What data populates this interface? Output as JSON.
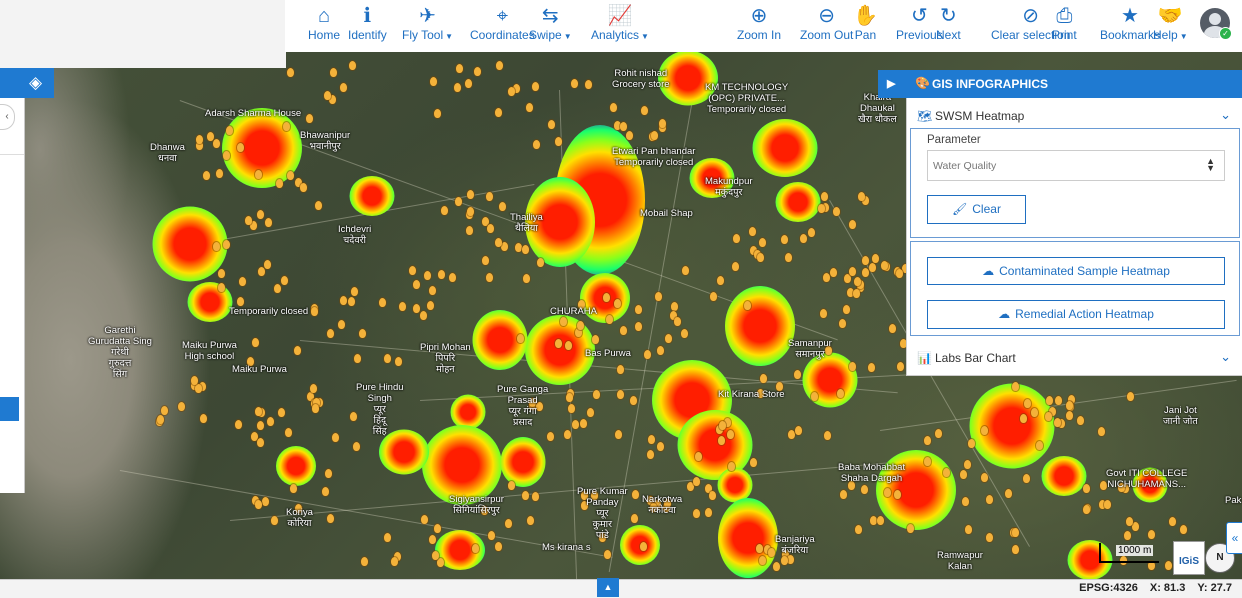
{
  "toolbar": {
    "items": [
      {
        "label": "Home",
        "icon": "home-icon",
        "glyph": "⌂"
      },
      {
        "label": "Identify",
        "icon": "info-icon",
        "glyph": "ℹ"
      },
      {
        "label": "Fly Tool",
        "icon": "fly-tool-icon",
        "glyph": "✈",
        "dropdown": true
      },
      {
        "label": "Coordinates",
        "icon": "map-pin-icon",
        "glyph": "⌖"
      },
      {
        "label": "Swipe",
        "icon": "swipe-icon",
        "glyph": "⇆",
        "dropdown": true
      },
      {
        "label": "Analytics",
        "icon": "analytics-icon",
        "glyph": "📈",
        "dropdown": true
      },
      {
        "label": "Zoom In",
        "icon": "zoom-in-icon",
        "glyph": "⊕"
      },
      {
        "label": "Zoom Out",
        "icon": "zoom-out-icon",
        "glyph": "⊖"
      },
      {
        "label": "Pan",
        "icon": "hand-icon",
        "glyph": "✋"
      },
      {
        "label": "Previous",
        "icon": "undo-icon",
        "glyph": "↺"
      },
      {
        "label": "Next",
        "icon": "redo-icon",
        "glyph": "↻"
      },
      {
        "label": "Clear selection",
        "icon": "eye-slash-icon",
        "glyph": "⊘"
      },
      {
        "label": "Print",
        "icon": "printer-icon",
        "glyph": "⎙"
      },
      {
        "label": "Bookmarks",
        "icon": "star-icon",
        "glyph": "★"
      },
      {
        "label": "Help",
        "icon": "handshake-icon",
        "glyph": "🤝",
        "dropdown": true
      }
    ],
    "dropdown_caret": "▼",
    "accent": "#1f6fc1"
  },
  "infographics": {
    "title": "GIS INFOGRAPHICS",
    "play_glyph": "▶",
    "title_icon_glyph": "🎨",
    "swsm": {
      "label": "SWSM Heatmap",
      "icon_glyph": "🗺",
      "chevron": "⌄",
      "parameter_label": "Parameter",
      "parameter_value": "Water Quality",
      "select_arrows": "▲\n▼",
      "clear_label": "Clear",
      "clear_icon": "🖌"
    },
    "contaminated_label": "Contaminated Sample Heatmap",
    "remedial_label": "Remedial Action Heatmap",
    "cloud_glyph": "☁",
    "labs": {
      "label": "Labs Bar Chart",
      "icon_glyph": "📊",
      "chevron": "⌄"
    }
  },
  "map_labels": [
    "Adarsh Sharma House",
    "Dhanwa\nधनवा",
    "Bhawanipur\nभवानीपुर",
    "Rohit nishad\nGrocery store",
    "KM TECHNOLOGY\n(OPC) PRIVATE...\nTemporarily closed",
    "Khaira\nDhaukal\nखैरा धौकल",
    "Etwari Pan bhandar\nTemporarily closed",
    "Makundpur\nमकुंदपुर",
    "Thailiya\nथैलिया",
    "Mobail Shap",
    "Ichdevri\nचदेवरी",
    "Garethi\nGurudatta Sing\nगरेथी\nगुरुदत्त\nसिंग",
    "Maiku Purwa\nHigh school",
    "Maiku Purwa",
    "Pipri Mohan\nपिपरि\nमोहन",
    "Bas Purwa",
    "Samanpur\nसमानपुर",
    "Pure Hindu\nSingh\nप्यूर\nहिंदू\nसिंह",
    "Pure Ganga\nPrasad\nप्यूर गंगा\nप्रसाद",
    "Kit Kirana Store",
    "Jani Jot\nजानी जोत",
    "Baba Mohabbat\nShaha Dargah",
    "Govt ITI COLLEGE\nNICHUHAMANS...",
    "Sigiyansirpur\nसिगियांसिरपुर",
    "Pure Kumar\nPanday\nप्यूर\nकुमार\nपांडे",
    "Narkotwa\nनकोटवा",
    "Banjariya\nबंजरिया",
    "Ramwapur\nKalan",
    "Koriya\nकोरिया",
    "Ms kirana s",
    "Pak",
    "Temporarily closed",
    "CHURAHA"
  ],
  "status": {
    "epsg": "EPSG:4326",
    "x": "X: 81.3",
    "y": "Y: 27.7"
  },
  "scale_label": "1000 m",
  "logo_text": "IGiS",
  "compass_text": "N",
  "expander_glyph": "«",
  "bottom_toggle_glyph": "▲",
  "layers_icon_glyph": "◈",
  "left_tab_glyph": "‹",
  "avatar_status_glyph": "✓",
  "colors": {
    "panel_blue": "#1f7ad1",
    "heat_core": "#ff1e00",
    "pin_orange": "#f4b23a"
  }
}
